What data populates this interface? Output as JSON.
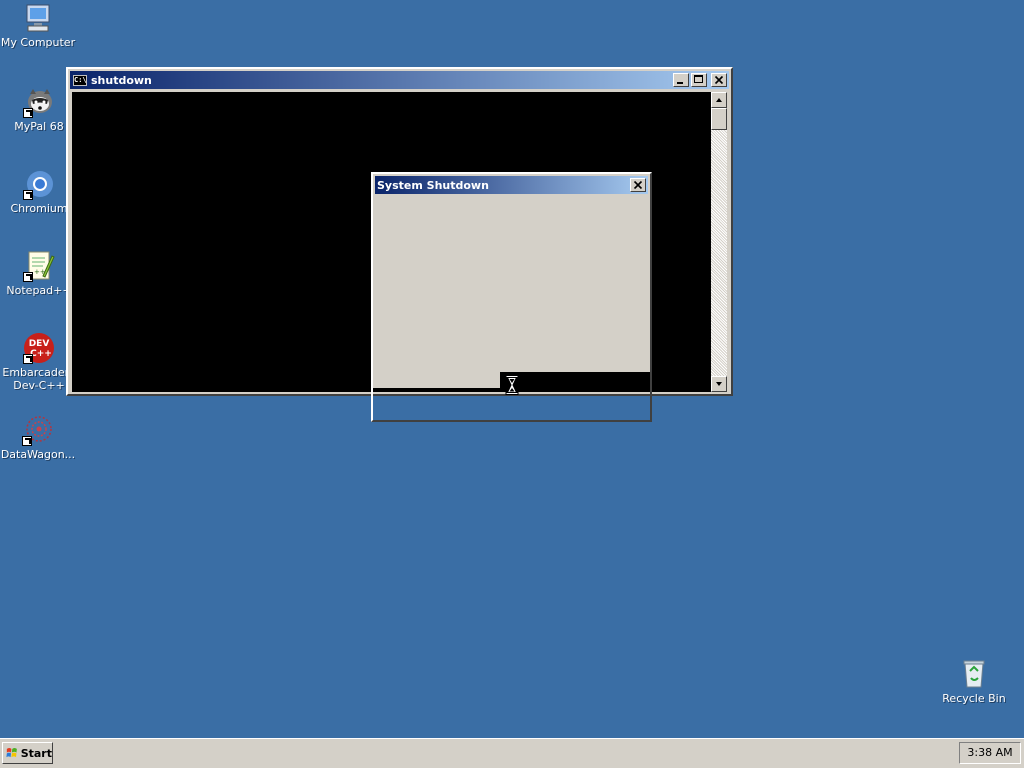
{
  "desktop": {
    "icons": [
      {
        "label": "My Computer",
        "icon": "my-computer-icon"
      },
      {
        "label": "MyPal 68",
        "icon": "mypal-raccoon-icon"
      },
      {
        "label": "Chromium",
        "icon": "chromium-icon"
      },
      {
        "label": "Notepad++",
        "icon": "notepad-plus-plus-icon"
      },
      {
        "label": "Embarcadero Dev-C++",
        "icon": "dev-cpp-icon"
      },
      {
        "label": "DataWagon...",
        "icon": "datawagon-icon"
      }
    ],
    "recycle_bin": {
      "label": "Recycle Bin",
      "icon": "recycle-bin-icon"
    }
  },
  "console_window": {
    "title": "shutdown",
    "title_icon": "console-icon",
    "buttons": [
      "minimize",
      "maximize",
      "close"
    ]
  },
  "shutdown_dialog": {
    "title": "System Shutdown",
    "cursor": "hourglass-icon"
  },
  "taskbar": {
    "start_label": "Start",
    "clock": "3:38 AM"
  },
  "colors": {
    "desktop": "#3a6ea5",
    "title_active_start": "#0a246a",
    "title_active_end": "#a6caf0",
    "face": "#d4d0c8",
    "console_bg": "#000000"
  }
}
